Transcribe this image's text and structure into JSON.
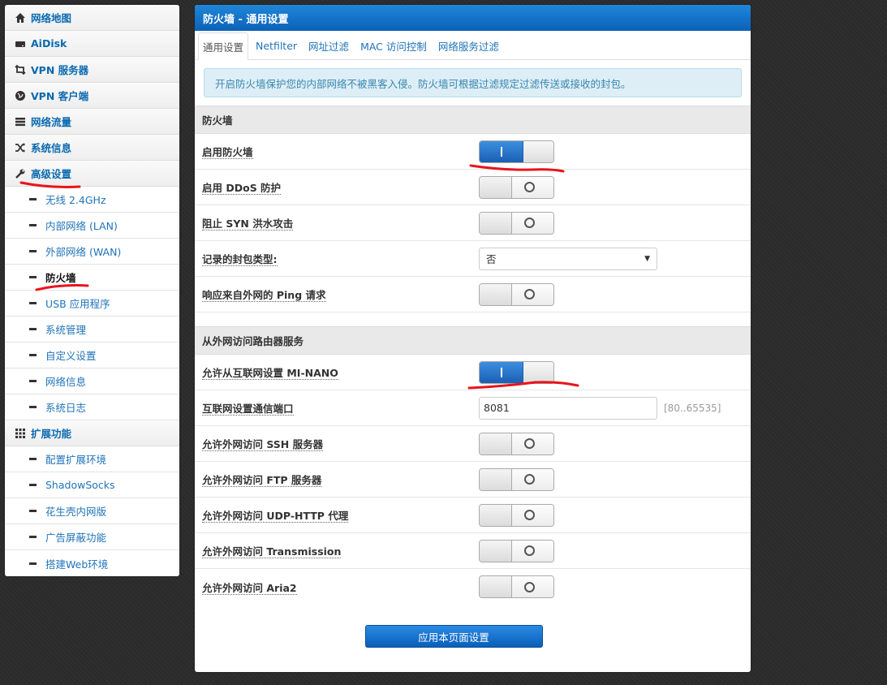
{
  "sidebar": {
    "items": [
      {
        "label": "网络地图",
        "icon": "home-icon"
      },
      {
        "label": "AiDisk",
        "icon": "disk-icon"
      },
      {
        "label": "VPN 服务器",
        "icon": "retweet-icon"
      },
      {
        "label": "VPN 客户端",
        "icon": "globe-icon"
      },
      {
        "label": "网络流量",
        "icon": "tasks-icon"
      },
      {
        "label": "系统信息",
        "icon": "random-icon"
      },
      {
        "label": "高级设置",
        "icon": "wrench-icon"
      }
    ],
    "advanced_sub": [
      {
        "label": "无线 2.4GHz"
      },
      {
        "label": "内部网络 (LAN)"
      },
      {
        "label": "外部网络 (WAN)"
      },
      {
        "label": "防火墙"
      },
      {
        "label": "USB 应用程序"
      },
      {
        "label": "系统管理"
      },
      {
        "label": "自定义设置"
      },
      {
        "label": "网络信息"
      },
      {
        "label": "系统日志"
      }
    ],
    "extensions": {
      "label": "扩展功能",
      "icon": "grid-icon"
    },
    "extensions_sub": [
      {
        "label": "配置扩展环境"
      },
      {
        "label": "ShadowSocks"
      },
      {
        "label": "花生壳内网版"
      },
      {
        "label": "广告屏蔽功能"
      },
      {
        "label": "搭建Web环境"
      }
    ]
  },
  "panel": {
    "title": "防火墙 - 通用设置",
    "tabs": [
      "通用设置",
      "Netfilter",
      "网址过滤",
      "MAC 访问控制",
      "网络服务过滤"
    ],
    "notice": "开启防火墙保护您的内部网络不被黑客入侵。防火墙可根据过滤规定过滤传送或接收的封包。",
    "section1": {
      "title": "防火墙",
      "rows": [
        {
          "label": "启用防火墙",
          "state": "on"
        },
        {
          "label": "启用 DDoS 防护",
          "state": "off"
        },
        {
          "label": "阻止 SYN 洪水攻击",
          "state": "off"
        },
        {
          "label": "记录的封包类型:",
          "select_value": "否"
        },
        {
          "label": "响应来自外网的 Ping 请求",
          "state": "off"
        }
      ]
    },
    "section2": {
      "title": "从外网访问路由器服务",
      "rows": [
        {
          "label": "允许从互联网设置 MI-NANO",
          "state": "on"
        },
        {
          "label": "互联网设置通信端口",
          "input_value": "8081",
          "hint": "[80..65535]"
        },
        {
          "label": "允许外网访问 SSH 服务器",
          "state": "off"
        },
        {
          "label": "允许外网访问 FTP 服务器",
          "state": "off"
        },
        {
          "label": "允许外网访问 UDP-HTTP 代理",
          "state": "off"
        },
        {
          "label": "允许外网访问 Transmission",
          "state": "off"
        },
        {
          "label": "允许外网访问 Aria2",
          "state": "off"
        }
      ]
    },
    "apply_label": "应用本页面设置"
  },
  "colors": {
    "accent": "#0b62b8",
    "link": "#1f73b8",
    "annotation": "#e8141b"
  }
}
